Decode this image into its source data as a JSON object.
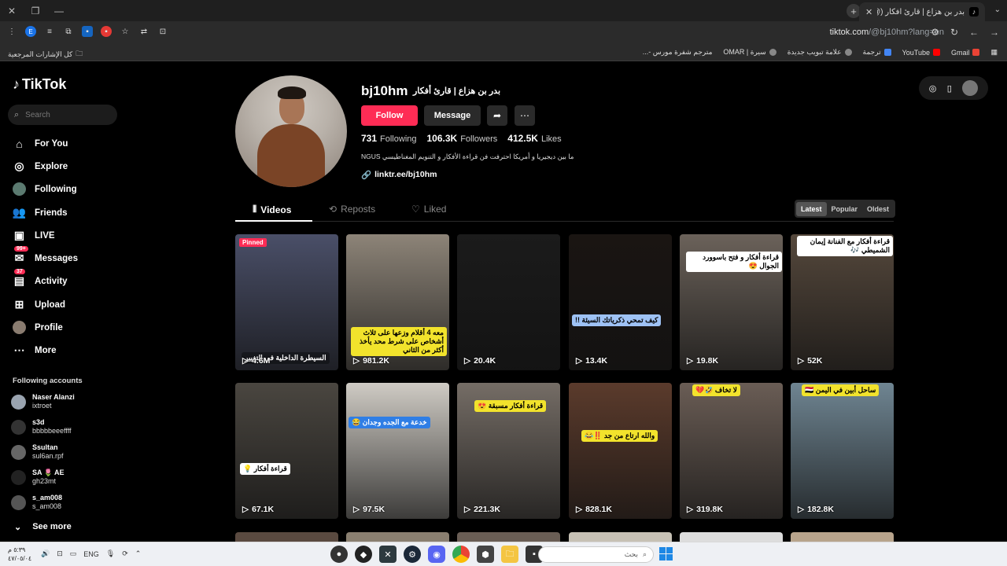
{
  "browser": {
    "tab_title": "بدر بن هزاع | قارئ أفكار (@bj10hm) |",
    "url_host": "tiktok.com",
    "url_path": "/@bj10hm?lang=en",
    "bookmarks_left": "كل الإشارات المرجعية",
    "bookmarks": [
      "Gmail",
      "YouTube",
      "ترجمة",
      "علامة تبويب جديدة",
      "سيرة | OMAR",
      "مترجم شفرة مورس -..."
    ]
  },
  "sidebar": {
    "logo": "TikTok",
    "search_placeholder": "Search",
    "nav": [
      {
        "label": "For You",
        "icon": "home-icon"
      },
      {
        "label": "Explore",
        "icon": "compass-icon"
      },
      {
        "label": "Following",
        "icon": "following-avatar-icon"
      },
      {
        "label": "Friends",
        "icon": "friends-icon"
      },
      {
        "label": "LIVE",
        "icon": "live-icon"
      },
      {
        "label": "Messages",
        "icon": "messages-icon",
        "badge": "99+"
      },
      {
        "label": "Activity",
        "icon": "activity-icon",
        "badge": "37"
      },
      {
        "label": "Upload",
        "icon": "upload-icon"
      },
      {
        "label": "Profile",
        "icon": "profile-avatar-icon"
      },
      {
        "label": "More",
        "icon": "more-icon"
      }
    ],
    "following_title": "Following accounts",
    "accounts": [
      {
        "name": "Naser Alanzi",
        "handle": "ixtroet"
      },
      {
        "name": "s3d",
        "handle": "bbbbbeeeffff"
      },
      {
        "name": "Ssultan",
        "handle": "sul6an.rpf"
      },
      {
        "name": "SA 🌷 AE",
        "handle": "gh23mt"
      },
      {
        "name": "s_am008",
        "handle": "s_am008"
      }
    ],
    "see_more": "See more"
  },
  "profile": {
    "username": "bj10hm",
    "nickname": "بدر بن هزاع | قارئ أفكار",
    "follow": "Follow",
    "message": "Message",
    "following_count": "731",
    "following_label": "Following",
    "followers_count": "106.3K",
    "followers_label": "Followers",
    "likes_count": "412.5K",
    "likes_label": "Likes",
    "bio": "NGUS ما بين ديجيريا و أمريكا احترفت فن قراءة الأفكار و التنويم المغناطيسي",
    "link": "linktr.ee/bj10hm"
  },
  "tabs": {
    "videos": "Videos",
    "reposts": "Reposts",
    "liked": "Liked"
  },
  "sort": {
    "latest": "Latest",
    "popular": "Popular",
    "oldest": "Oldest"
  },
  "videos": [
    {
      "views": "4.6M",
      "pinned": "Pinned",
      "bg": "#4a4f68",
      "overlay": "السيطرة الداخلية في التغيير"
    },
    {
      "views": "981.2K",
      "bg": "#8d8478",
      "overlay": "معه 4 أقلام وزعها على ثلاث أشخاص على شرط محد يأخذ أكثر من الثاني"
    },
    {
      "views": "20.4K",
      "bg": "#1b1b1b",
      "overlay": ""
    },
    {
      "views": "13.4K",
      "bg": "#1a1512",
      "overlay": "كيف تمحي ذكرياتك السيئة !!"
    },
    {
      "views": "19.8K",
      "bg": "#6b625a",
      "overlay": "قراءة أفكار و فتح باسوورد الجوال 😍"
    },
    {
      "views": "52K",
      "bg": "#55483c",
      "overlay": "قراءة أفكار مع الفنانة إيمان الشميطي 🎶"
    },
    {
      "views": "67.1K",
      "bg": "#4a4640",
      "overlay": "قراءة أفكار 💡"
    },
    {
      "views": "97.5K",
      "bg": "#cfcbc4",
      "overlay": "خدعة مع الجده وجدان 😂"
    },
    {
      "views": "221.3K",
      "bg": "#756d66",
      "overlay": "قراءة أفكار مسبقة 😍"
    },
    {
      "views": "828.1K",
      "bg": "#5b3b2c",
      "overlay": "والله ارتاع من جد ‼️😂"
    },
    {
      "views": "319.8K",
      "bg": "#6a5d55",
      "overlay": "لا تخاف 🤣💔"
    },
    {
      "views": "182.8K",
      "bg": "#6f8592",
      "overlay": "ساحل أبين في اليمن 🇾🇪"
    }
  ],
  "taskbar": {
    "time": "٥:٣٩ م",
    "date": "٤٧/٠٥/٠٤",
    "lang": "ENG",
    "search": "بحث"
  }
}
